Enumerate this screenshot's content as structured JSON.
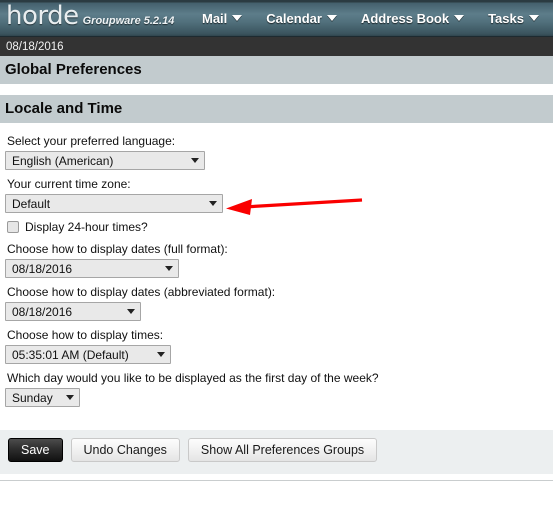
{
  "header": {
    "logo": "horde",
    "product": "Groupware 5.2.14",
    "nav": [
      {
        "label": "Mail",
        "icon": "chevron-down-icon"
      },
      {
        "label": "Calendar",
        "icon": "chevron-down-icon"
      },
      {
        "label": "Address Book",
        "icon": "chevron-down-icon"
      },
      {
        "label": "Tasks",
        "icon": "chevron-down-icon"
      }
    ],
    "date": "08/18/2016"
  },
  "page": {
    "title": "Global Preferences",
    "section_title": "Locale and Time"
  },
  "form": {
    "language": {
      "label": "Select your preferred language:",
      "value": "English (American)"
    },
    "timezone": {
      "label": "Your current time zone:",
      "value": "Default"
    },
    "twentyfour_hour": {
      "label": "Display 24-hour times?",
      "checked": false
    },
    "date_full": {
      "label": "Choose how to display dates (full format):",
      "value": "08/18/2016"
    },
    "date_abbrev": {
      "label": "Choose how to display dates (abbreviated format):",
      "value": "08/18/2016"
    },
    "time_format": {
      "label": "Choose how to display times:",
      "value": "05:35:01 AM (Default)"
    },
    "first_day": {
      "label": "Which day would you like to be displayed as the first day of the week?",
      "value": "Sunday"
    }
  },
  "buttons": {
    "save": "Save",
    "undo": "Undo Changes",
    "show_all": "Show All Preferences Groups"
  },
  "annotation": {
    "type": "arrow",
    "color": "#fa0000",
    "points_to": "timezone-select"
  }
}
